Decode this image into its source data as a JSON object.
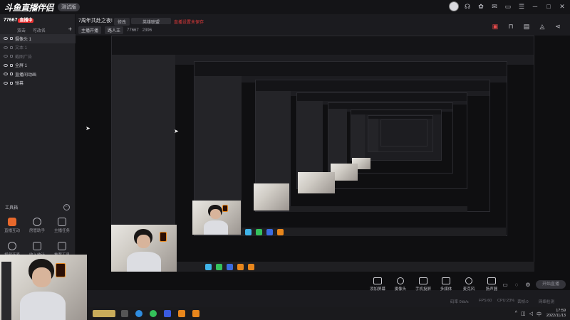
{
  "app": {
    "logo": "斗鱼直播伴侣",
    "version_badge": "测试版"
  },
  "titlebar_icons": [
    "headset-icon",
    "gift-icon",
    "mail-icon",
    "window-icon",
    "settings-icon",
    "minimize-icon",
    "maximize-icon",
    "close-icon"
  ],
  "room": {
    "id": "77667",
    "tag": "直播中"
  },
  "scene_tabs": [
    "双击",
    "可改名"
  ],
  "sources": [
    {
      "label": "摄像头 1",
      "state": "sel"
    },
    {
      "label": "文本 1",
      "state": "dim"
    },
    {
      "label": "截图广告",
      "state": "dim"
    },
    {
      "label": "全屏 1",
      "state": "on"
    },
    {
      "label": "直播间动画",
      "state": "on"
    },
    {
      "label": "弹幕",
      "state": "on"
    }
  ],
  "tools_panel": {
    "label": "工具箱",
    "items": [
      {
        "label": "直播互动",
        "icon": "live-interact-icon",
        "highlight": true
      },
      {
        "label": "房管助手",
        "icon": "admin-assistant-icon",
        "highlight": false
      },
      {
        "label": "主播任务",
        "icon": "anchor-task-icon",
        "highlight": false
      },
      {
        "label": "视频连麦",
        "icon": "video-link-icon",
        "highlight": false
      },
      {
        "label": "收入统计",
        "icon": "download-icon",
        "highlight": false
      },
      {
        "label": "推荐工具",
        "icon": "recommend-icon",
        "highlight": false
      }
    ]
  },
  "header": {
    "title": "7周年共赴之夜!",
    "tag_button": "修改",
    "category": "英雄联盟",
    "warning": "直播设置未保存",
    "sub_label": "主播开播",
    "sub_tag": "路人王",
    "followers": "77667",
    "heat": "2396"
  },
  "header_icons": [
    "gift-box-icon",
    "lock-icon",
    "card-icon",
    "bell-icon",
    "share-icon"
  ],
  "controls": [
    {
      "label": "添加屏幕",
      "icon": "screen-icon"
    },
    {
      "label": "摄像头",
      "icon": "camera-icon"
    },
    {
      "label": "手机投屏",
      "icon": "phone-cast-icon"
    },
    {
      "label": "多媒体",
      "icon": "media-icon"
    },
    {
      "label": "麦克风",
      "icon": "mic-icon"
    },
    {
      "label": "扬声器",
      "icon": "speaker-icon"
    }
  ],
  "start_button": "开始直播",
  "status": {
    "bitrate": "码率 0kb/s",
    "fps": "FPS:60",
    "cpu": "CPU:23%",
    "drop": "丢帧:0",
    "net": "网络检测"
  },
  "clock": {
    "time": "17:59",
    "date": "2022/11/13"
  }
}
